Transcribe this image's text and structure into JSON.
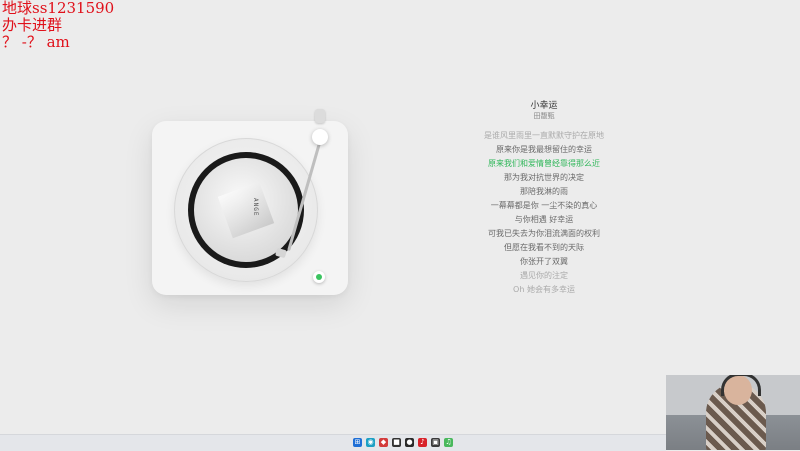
{
  "overlay": {
    "line1": "地球ss1231590",
    "line2": "办卡进群",
    "line3": "？ -？ am"
  },
  "player": {
    "record_label": "ANGE"
  },
  "song": {
    "title": "小幸运",
    "artist": "田馥甄",
    "lyrics": [
      "是谁风里雨里一直默默守护在原地",
      "原来你是我最想留住的幸运",
      "原来我们和爱情曾经靠得那么近",
      "那为我对抗世界的决定",
      "那陪我淋的雨",
      "一幕幕都是你 一尘不染的真心",
      "与你相遇 好幸运",
      "可我已失去为你泪流满面的权利",
      "但愿在我看不到的天际",
      "你张开了双翼",
      "遇见你的注定",
      "Oh 她会有多幸运"
    ],
    "active_index": 2
  },
  "taskbar": {
    "icons": [
      {
        "name": "windows-start-icon",
        "color": "#1f6fd6",
        "glyph": "⊞"
      },
      {
        "name": "edge-icon",
        "color": "#1da0c4",
        "glyph": "◉"
      },
      {
        "name": "browser-icon",
        "color": "#d33b3b",
        "glyph": "◆"
      },
      {
        "name": "app-icon",
        "color": "#333333",
        "glyph": "■"
      },
      {
        "name": "record-app-icon",
        "color": "#2a2a2a",
        "glyph": "●"
      },
      {
        "name": "music-app-icon",
        "color": "#d8232a",
        "glyph": "♪"
      },
      {
        "name": "capture-app-icon",
        "color": "#3a3a3a",
        "glyph": "▣"
      },
      {
        "name": "music-player-icon",
        "color": "#49b85c",
        "glyph": "♫"
      }
    ]
  }
}
